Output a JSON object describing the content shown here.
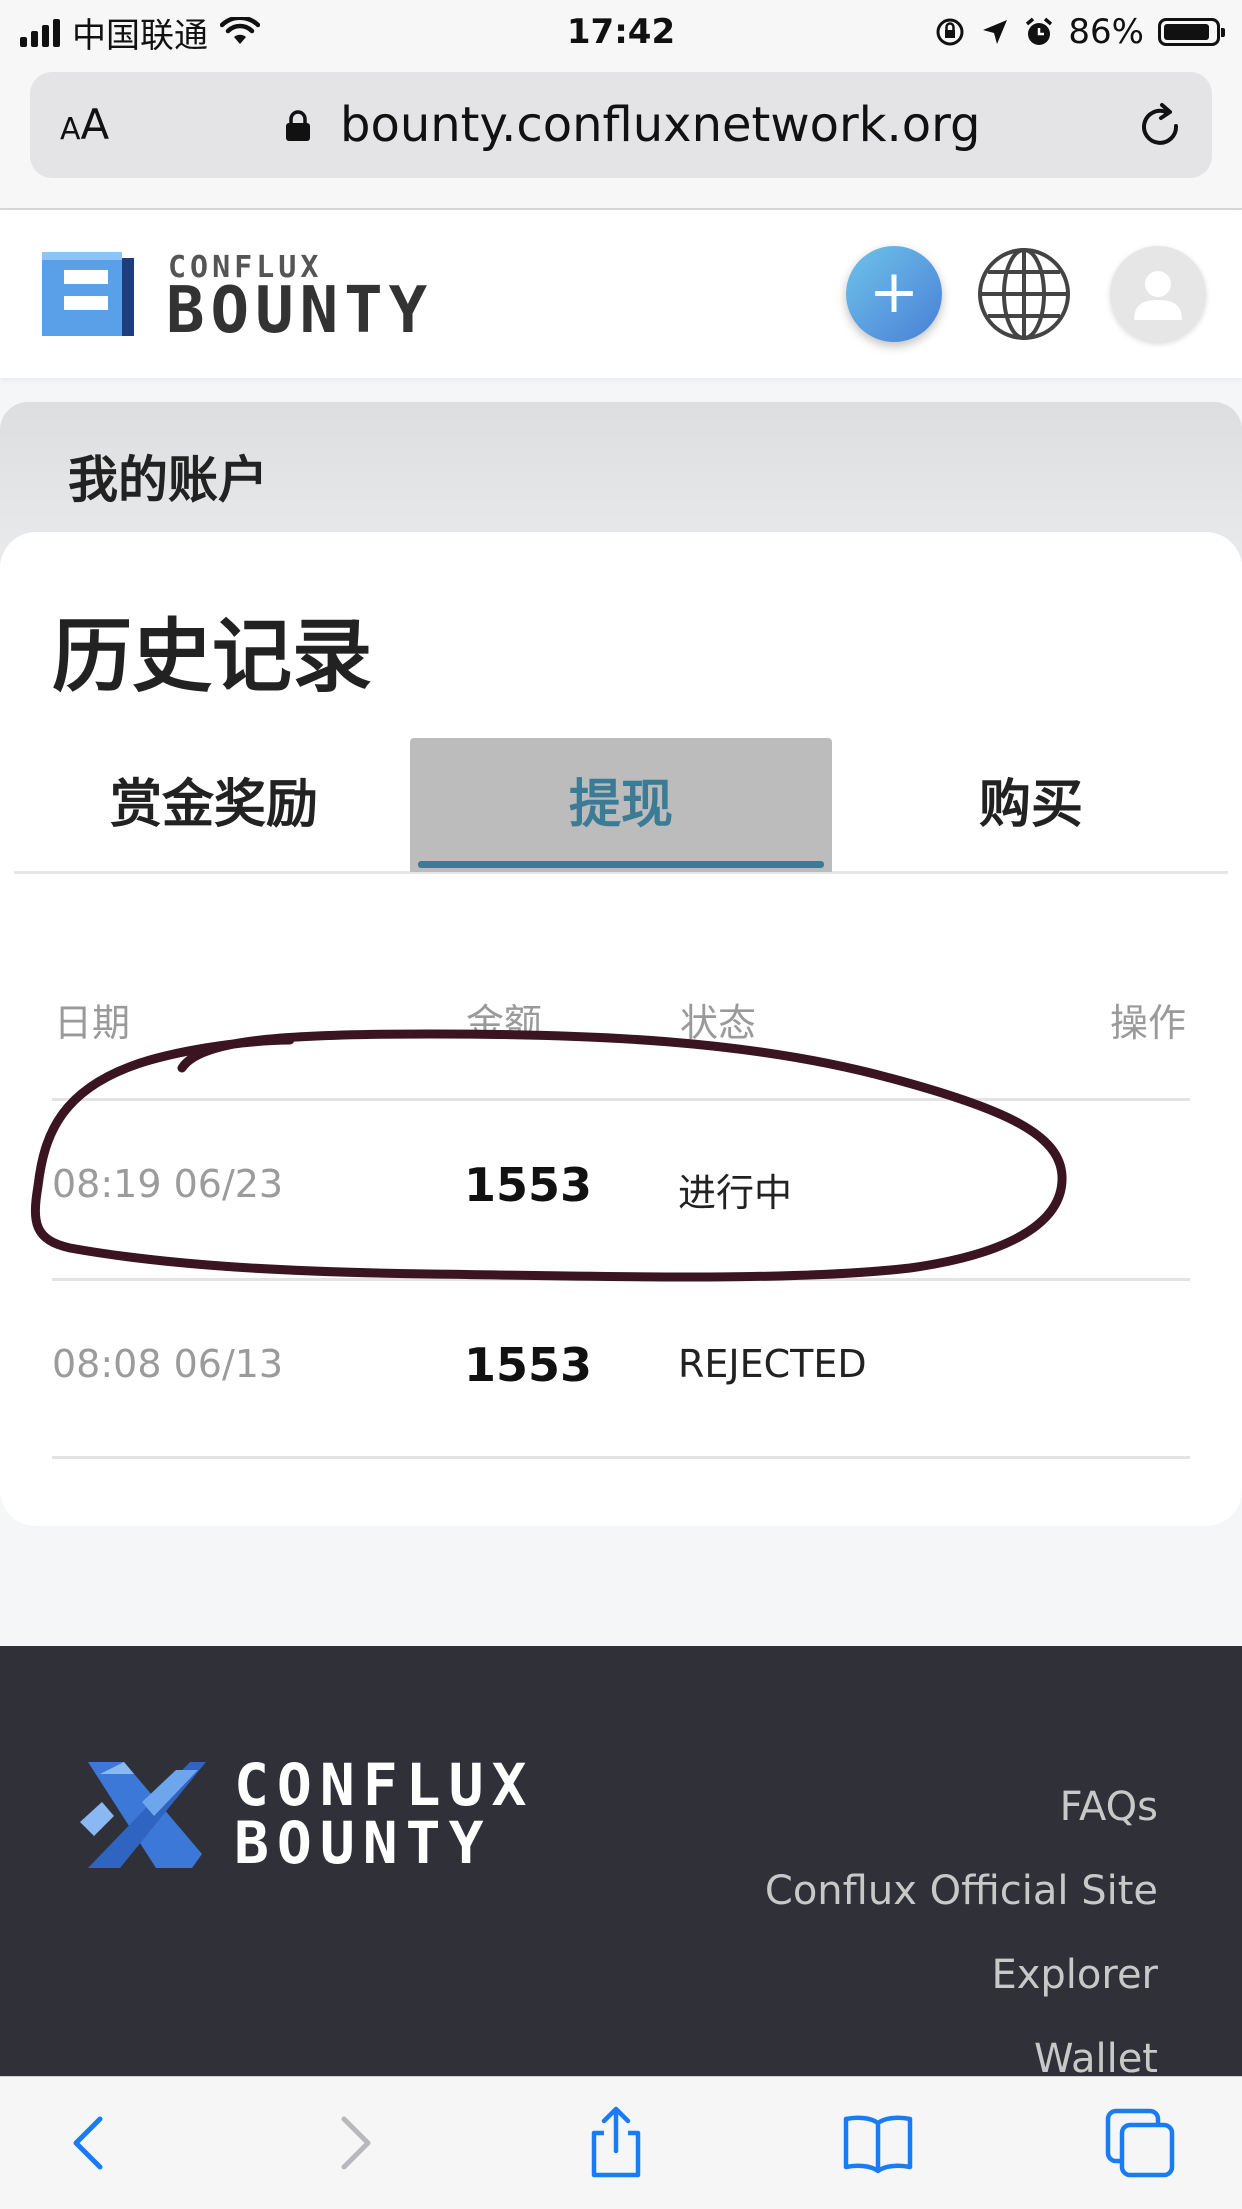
{
  "status_bar": {
    "carrier": "中国联通",
    "time": "17:42",
    "battery": "86%"
  },
  "browser": {
    "aa_small": "A",
    "aa_large": "A",
    "url": "bounty.confluxnetwork.org"
  },
  "header": {
    "logo_small": "CONFLUX",
    "logo_big": "BOUNTY",
    "plus_label": "+"
  },
  "account": {
    "title": "我的账户"
  },
  "history": {
    "title": "历史记录",
    "tabs": [
      {
        "label": "赏金奖励",
        "active": false
      },
      {
        "label": "提现",
        "active": true
      },
      {
        "label": "购买",
        "active": false
      }
    ],
    "columns": {
      "date": "日期",
      "amount": "金额",
      "status": "状态",
      "operation": "操作"
    },
    "rows": [
      {
        "date": "08:19 06/23",
        "amount": "1553",
        "status": "进行中"
      },
      {
        "date": "08:08 06/13",
        "amount": "1553",
        "status": "REJECTED"
      }
    ]
  },
  "footer": {
    "logo_line1": "CONFLUX",
    "logo_line2": "BOUNTY",
    "links": [
      "FAQs",
      "Conflux Official Site",
      "Explorer",
      "Wallet"
    ]
  },
  "colors": {
    "accent": "#3c7b95",
    "footer_bg": "#303138",
    "annotation": "#3a1420",
    "safari_blue": "#1a7cf5"
  }
}
